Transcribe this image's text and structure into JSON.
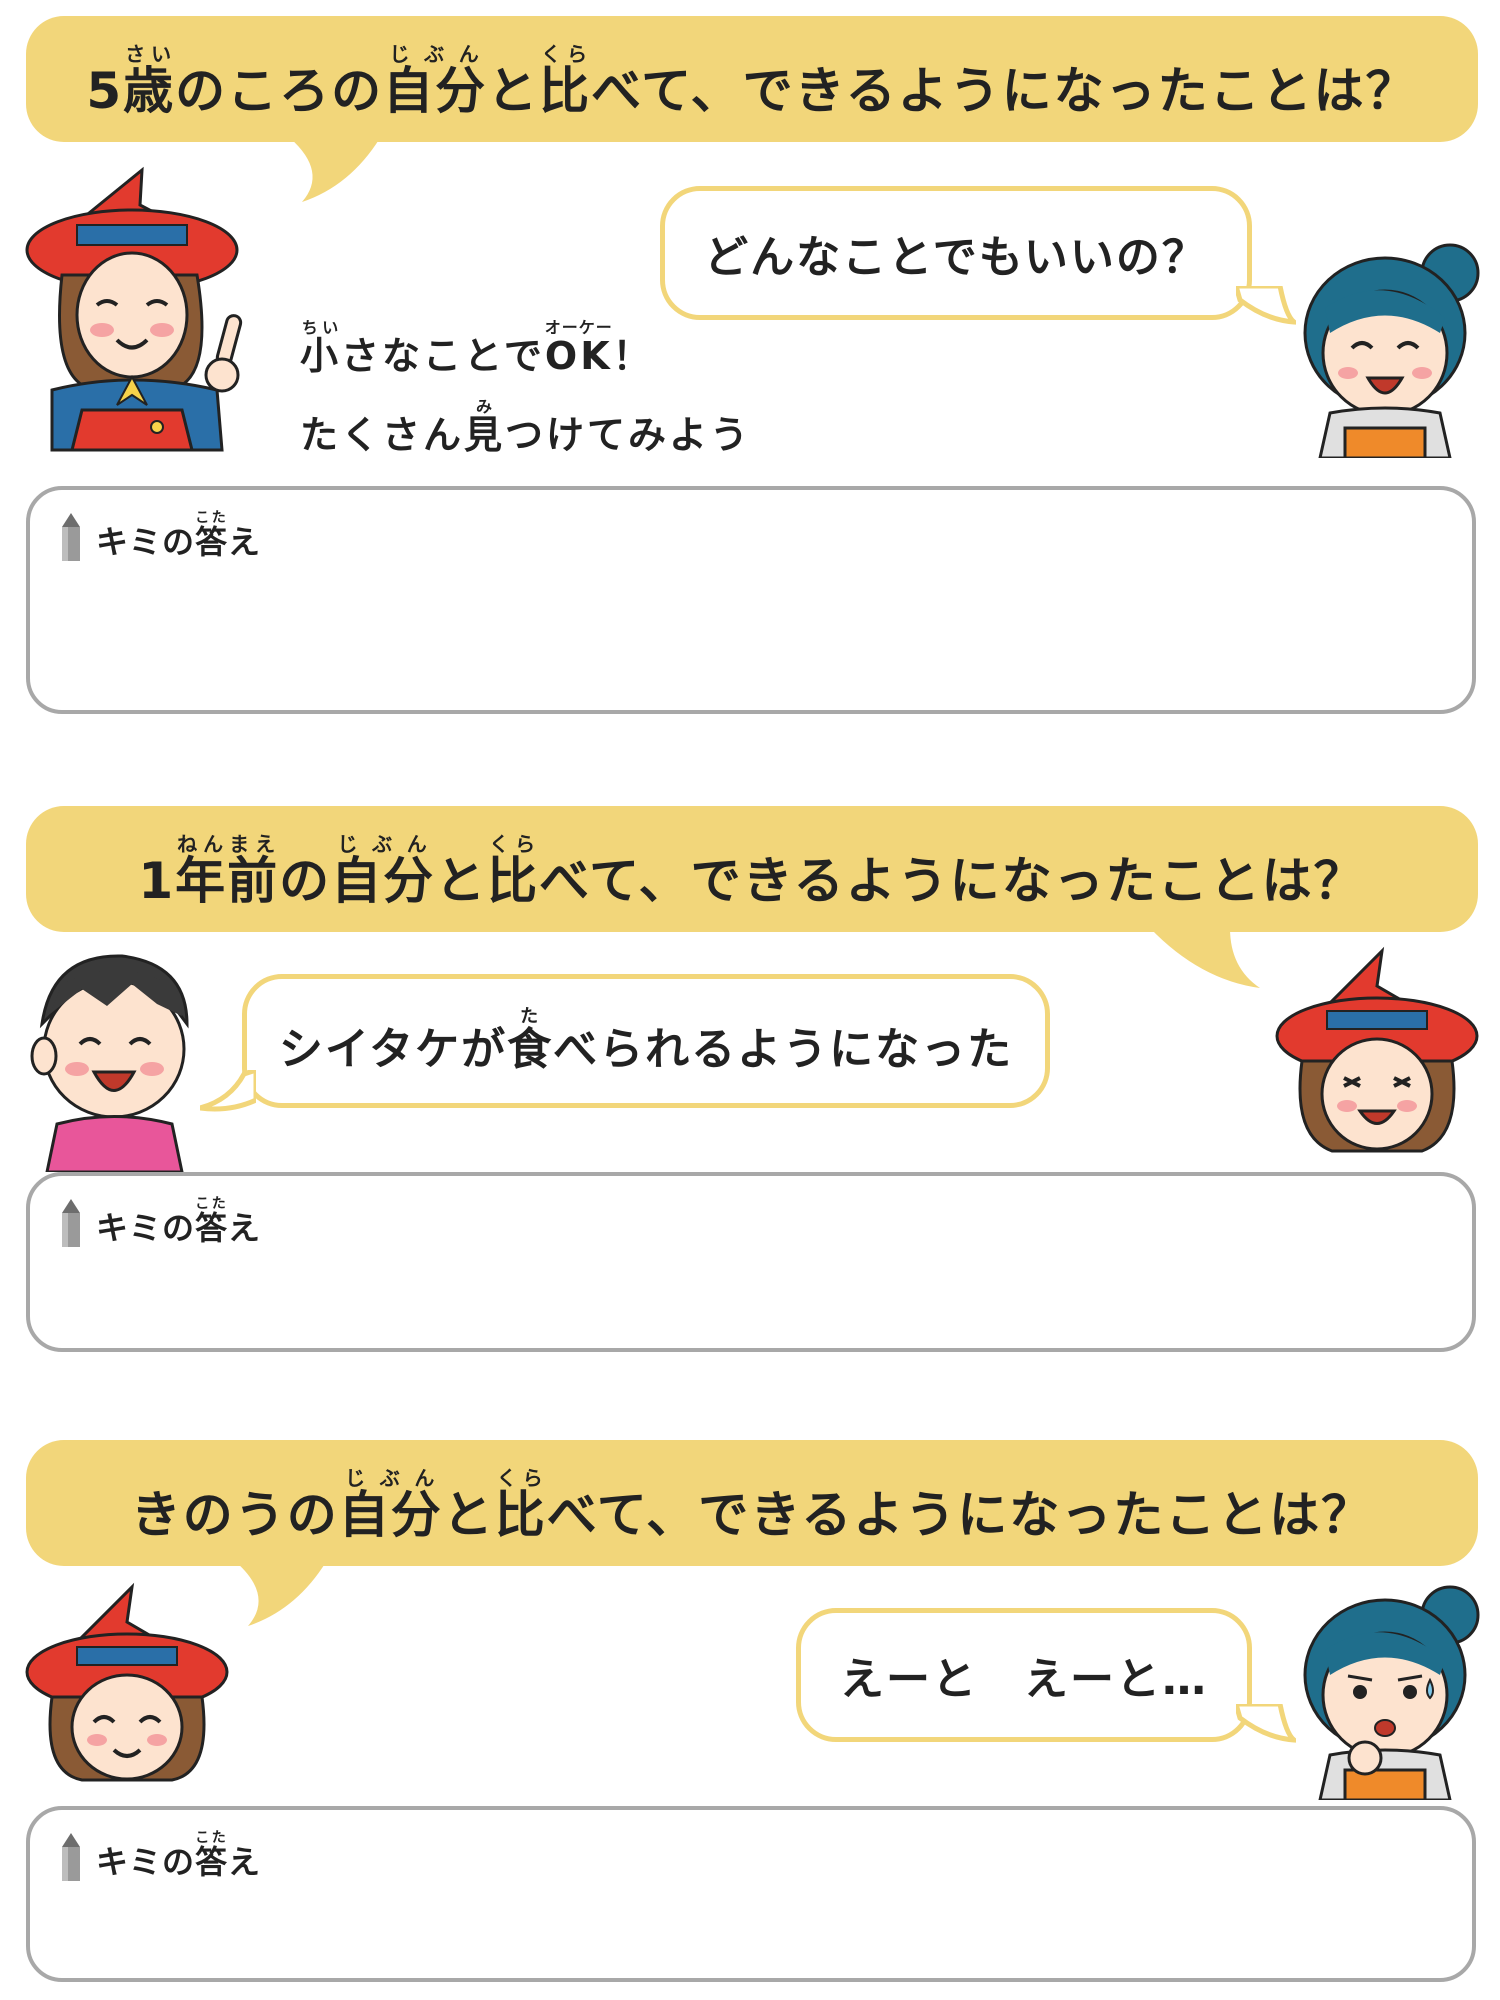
{
  "colors": {
    "banner": "#f2d67a",
    "answer_border": "#a8a8a8",
    "text": "#222222"
  },
  "answer_label": {
    "pre": "キミの",
    "kanji": "答",
    "reading": "こた",
    "post": "え",
    "icon": "pencil-icon"
  },
  "sections": [
    {
      "question": {
        "pre": "5",
        "k1": "歳",
        "r1": "さい",
        "mid1": "のころの",
        "k2": "自分",
        "r2": "じぶん",
        "mid2": "と",
        "k3": "比",
        "r3": "くら",
        "post": "べて、できるようになったことは？"
      },
      "reply": {
        "text": "どんなことでもいいの？"
      },
      "note": {
        "line1": {
          "k1": "小",
          "r1": "ちい",
          "mid": "さなことで",
          "k2": "OK",
          "r2": "オーケー",
          "post": "！"
        },
        "line2": {
          "pre": "たくさん",
          "k": "見",
          "r": "み",
          "post": "つけてみよう"
        }
      },
      "characters": [
        "witch-teacher",
        "blue-haired-girl"
      ]
    },
    {
      "question": {
        "pre": "1",
        "k1": "年前",
        "r1": "ねんまえ",
        "mid1": "の",
        "k2": "自分",
        "r2": "じぶん",
        "mid2": "と",
        "k3": "比",
        "r3": "くら",
        "post": "べて、できるようになったことは？"
      },
      "reply": {
        "pre": "シイタケが",
        "k": "食",
        "r": "た",
        "post": "べられるようになった"
      },
      "characters": [
        "boy-pink-shirt",
        "witch-teacher"
      ]
    },
    {
      "question": {
        "pre": "きのうの",
        "k2": "自分",
        "r2": "じぶん",
        "mid2": "と",
        "k3": "比",
        "r3": "くら",
        "post": "べて、できるようになったことは？"
      },
      "reply": {
        "text": "えーと　えーと…"
      },
      "characters": [
        "witch-teacher",
        "blue-haired-girl-thinking"
      ]
    }
  ]
}
